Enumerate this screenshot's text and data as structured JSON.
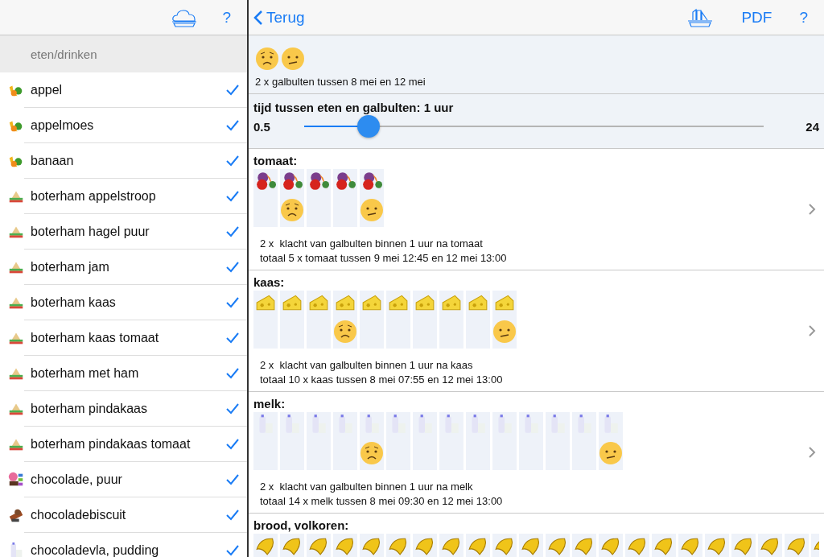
{
  "sidebar": {
    "help": "?",
    "section_title": "eten/drinken",
    "items": [
      {
        "label": "appel",
        "kind": "fruit",
        "checked": true
      },
      {
        "label": "appelmoes",
        "kind": "fruit",
        "checked": true
      },
      {
        "label": "banaan",
        "kind": "fruit",
        "checked": true
      },
      {
        "label": "boterham appelstroop",
        "kind": "sandwich",
        "checked": true
      },
      {
        "label": "boterham hagel puur",
        "kind": "sandwich",
        "checked": true
      },
      {
        "label": "boterham jam",
        "kind": "sandwich",
        "checked": true
      },
      {
        "label": "boterham kaas",
        "kind": "sandwich",
        "checked": true
      },
      {
        "label": "boterham kaas tomaat",
        "kind": "sandwich",
        "checked": true
      },
      {
        "label": "boterham met ham",
        "kind": "sandwich",
        "checked": true
      },
      {
        "label": "boterham pindakaas",
        "kind": "sandwich",
        "checked": true
      },
      {
        "label": "boterham pindakaas tomaat",
        "kind": "sandwich",
        "checked": true
      },
      {
        "label": "chocolade, puur",
        "kind": "chocolate",
        "checked": true
      },
      {
        "label": "chocoladebiscuit",
        "kind": "biscuit",
        "checked": true
      },
      {
        "label": "chocoladevla, pudding",
        "kind": "milk",
        "checked": true
      }
    ]
  },
  "toolbar": {
    "back": "Terug",
    "pdf": "PDF",
    "help": "?"
  },
  "summary": {
    "moods": [
      {
        "kind": "worried"
      },
      {
        "kind": "confused"
      }
    ],
    "text": "2 x galbulten tussen 8 mei en 12 mei"
  },
  "slider": {
    "label": "tijd tussen eten en galbulten: 1 uur",
    "min": "0.5",
    "max": "24",
    "level": 0.14
  },
  "sections": [
    {
      "title": "tomaat:",
      "kind": "vegetables",
      "cells": [
        {
          "kind": "empty"
        },
        {
          "kind": "worried"
        },
        {
          "kind": "empty"
        },
        {
          "kind": "empty"
        },
        {
          "kind": "confused"
        }
      ],
      "line_1": "2 x  klacht van galbulten binnen 1 uur na tomaat",
      "line_2": "totaal 5 x tomaat tussen 9 mei 12:45 en 12 mei 13:00"
    },
    {
      "title": "kaas:",
      "kind": "cheese",
      "cells": [
        {
          "kind": "empty"
        },
        {
          "kind": "empty"
        },
        {
          "kind": "empty"
        },
        {
          "kind": "worried"
        },
        {
          "kind": "empty"
        },
        {
          "kind": "empty"
        },
        {
          "kind": "empty"
        },
        {
          "kind": "empty"
        },
        {
          "kind": "empty"
        },
        {
          "kind": "confused"
        }
      ],
      "line_1": "2 x  klacht van galbulten binnen 1 uur na kaas",
      "line_2": "totaal 10 x kaas tussen 8 mei 07:55 en 12 mei 13:00"
    },
    {
      "title": "melk:",
      "kind": "milk",
      "cells": [
        {
          "kind": "empty"
        },
        {
          "kind": "empty"
        },
        {
          "kind": "empty"
        },
        {
          "kind": "empty"
        },
        {
          "kind": "worried"
        },
        {
          "kind": "empty"
        },
        {
          "kind": "empty"
        },
        {
          "kind": "empty"
        },
        {
          "kind": "empty"
        },
        {
          "kind": "empty"
        },
        {
          "kind": "empty"
        },
        {
          "kind": "empty"
        },
        {
          "kind": "empty"
        },
        {
          "kind": "confused"
        }
      ],
      "line_1": "2 x  klacht van galbulten binnen 1 uur na melk",
      "line_2": "totaal 14 x melk tussen 8 mei 09:30 en 12 mei 13:00"
    },
    {
      "title": "brood, volkoren:",
      "kind": "bread",
      "cells": [
        {
          "kind": "empty"
        },
        {
          "kind": "empty"
        },
        {
          "kind": "empty"
        },
        {
          "kind": "empty"
        },
        {
          "kind": "empty"
        },
        {
          "kind": "empty"
        },
        {
          "kind": "empty"
        },
        {
          "kind": "empty"
        },
        {
          "kind": "empty"
        },
        {
          "kind": "empty"
        },
        {
          "kind": "empty"
        },
        {
          "kind": "empty"
        },
        {
          "kind": "empty"
        },
        {
          "kind": "empty"
        },
        {
          "kind": "empty"
        },
        {
          "kind": "empty"
        },
        {
          "kind": "empty"
        },
        {
          "kind": "empty"
        },
        {
          "kind": "empty"
        },
        {
          "kind": "empty"
        },
        {
          "kind": "empty"
        },
        {
          "kind": "empty"
        }
      ]
    }
  ]
}
